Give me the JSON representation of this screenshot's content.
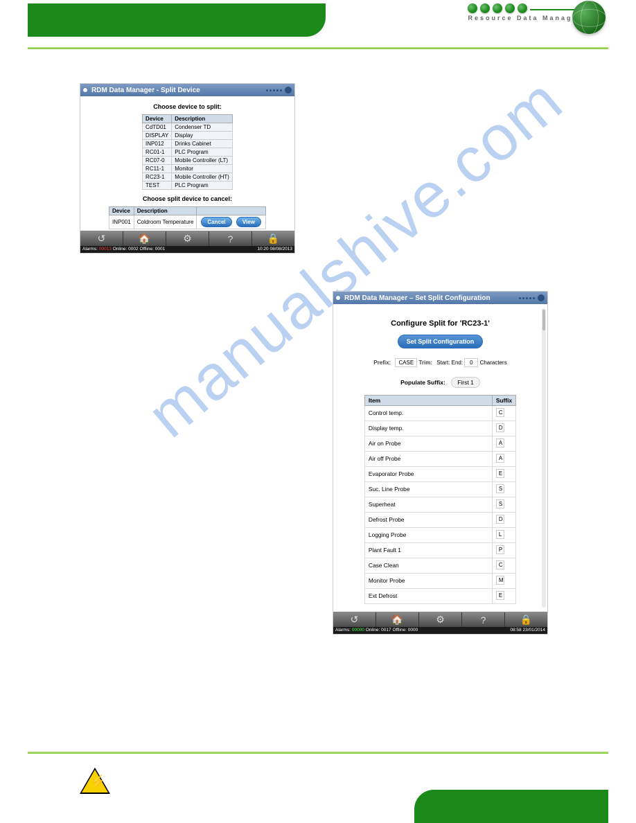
{
  "header": {
    "logo_text": "Resource Data Management"
  },
  "watermark": "manualshive.com",
  "screenshot1": {
    "title": "RDM Data Manager - Split Device",
    "choose_label": "Choose device to split:",
    "table_headers": {
      "device": "Device",
      "description": "Description"
    },
    "devices": [
      {
        "device": "CdTD01",
        "description": "Condenser TD"
      },
      {
        "device": "DISPLAY",
        "description": "Display"
      },
      {
        "device": "INP012",
        "description": "Drinks Cabinet"
      },
      {
        "device": "RC01-1",
        "description": "PLC Program"
      },
      {
        "device": "RC07-0",
        "description": "Mobile Controller (LT)"
      },
      {
        "device": "RC11-1",
        "description": "Monitor"
      },
      {
        "device": "RC23-1",
        "description": "Mobile Controller (HT)"
      },
      {
        "device": "TEST",
        "description": "PLC Program"
      }
    ],
    "cancel_label": "Choose split device to cancel:",
    "cancel_row": {
      "device": "INP001",
      "description": "Coldroom Temperature"
    },
    "buttons": {
      "cancel": "Cancel",
      "view": "View"
    },
    "status": {
      "alarms_label": "Alarms:",
      "alarms_value": "00013",
      "online_label": "Online:",
      "online_value": "0002",
      "offline_label": "Offline:",
      "offline_value": "0001",
      "time": "10:20 08/08/2013"
    }
  },
  "screenshot2": {
    "title": "RDM Data Manager – Set Split Configuration",
    "heading_prefix": "Configure Split for '",
    "heading_device": "RC23-1",
    "heading_suffix": "'",
    "set_button": "Set Split Configuration",
    "config": {
      "prefix_label": "Prefix:",
      "prefix_value": "CASE",
      "trim_label": "Trim:",
      "start_label": "Start:",
      "end_label": "End:",
      "end_value": "0",
      "characters_label": "Characters"
    },
    "populate_label": "Populate Suffix:",
    "populate_button": "First 1",
    "table_headers": {
      "item": "Item",
      "suffix": "Suffix"
    },
    "items": [
      {
        "item": "Control temp.",
        "suffix": "C"
      },
      {
        "item": "Display temp.",
        "suffix": "D"
      },
      {
        "item": "Air on Probe",
        "suffix": "A"
      },
      {
        "item": "Air off Probe",
        "suffix": "A"
      },
      {
        "item": "Evaporator Probe",
        "suffix": "E"
      },
      {
        "item": "Suc. Line Probe",
        "suffix": "S"
      },
      {
        "item": "Superheat",
        "suffix": "S"
      },
      {
        "item": "Defrost Probe",
        "suffix": "D"
      },
      {
        "item": "Logging Probe",
        "suffix": "L"
      },
      {
        "item": "Plant Fault 1",
        "suffix": "P"
      },
      {
        "item": "Case Clean",
        "suffix": "C"
      },
      {
        "item": "Monitor Probe",
        "suffix": "M"
      },
      {
        "item": "Ext Defrost",
        "suffix": "E"
      }
    ],
    "status": {
      "alarms_label": "Alarms:",
      "alarms_value": "00000",
      "online_label": "Online:",
      "online_value": "0017",
      "offline_label": "Offline:",
      "offline_value": "0000",
      "time": "08:58 23/01/2014"
    }
  }
}
